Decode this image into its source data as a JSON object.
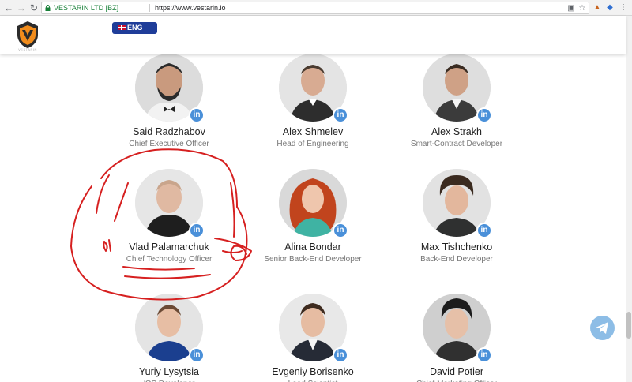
{
  "browser": {
    "site_label": "VESTARIN LTD [BZ]",
    "url": "https://www.vestarin.io"
  },
  "header": {
    "logo_text": "VESTARIN",
    "language_button": "ENG"
  },
  "team": [
    {
      "name": "Said Radzhabov",
      "role": "Chief Executive Officer",
      "li": "in"
    },
    {
      "name": "Alex Shmelev",
      "role": "Head of Engineering",
      "li": "in"
    },
    {
      "name": "Alex Strakh",
      "role": "Smart-Contract Developer",
      "li": "in"
    },
    {
      "name": "Vlad Palamarchuk",
      "role": "Chief Technology Officer",
      "li": "in"
    },
    {
      "name": "Alina Bondar",
      "role": "Senior Back-End Developer",
      "li": "in"
    },
    {
      "name": "Max Tishchenko",
      "role": "Back-End Developer",
      "li": "in"
    },
    {
      "name": "Yuriy Lysytsia",
      "role": "iOS Developer",
      "li": "in"
    },
    {
      "name": "Evgeniy Borisenko",
      "role": "Lead Scientist",
      "li": "in"
    },
    {
      "name": "David Potier",
      "role": "Chief Marketing Officer",
      "li": "in"
    }
  ],
  "colors": {
    "accent": "#1f3d99",
    "linkedin": "#4a90d9",
    "annotation": "#d62020"
  }
}
